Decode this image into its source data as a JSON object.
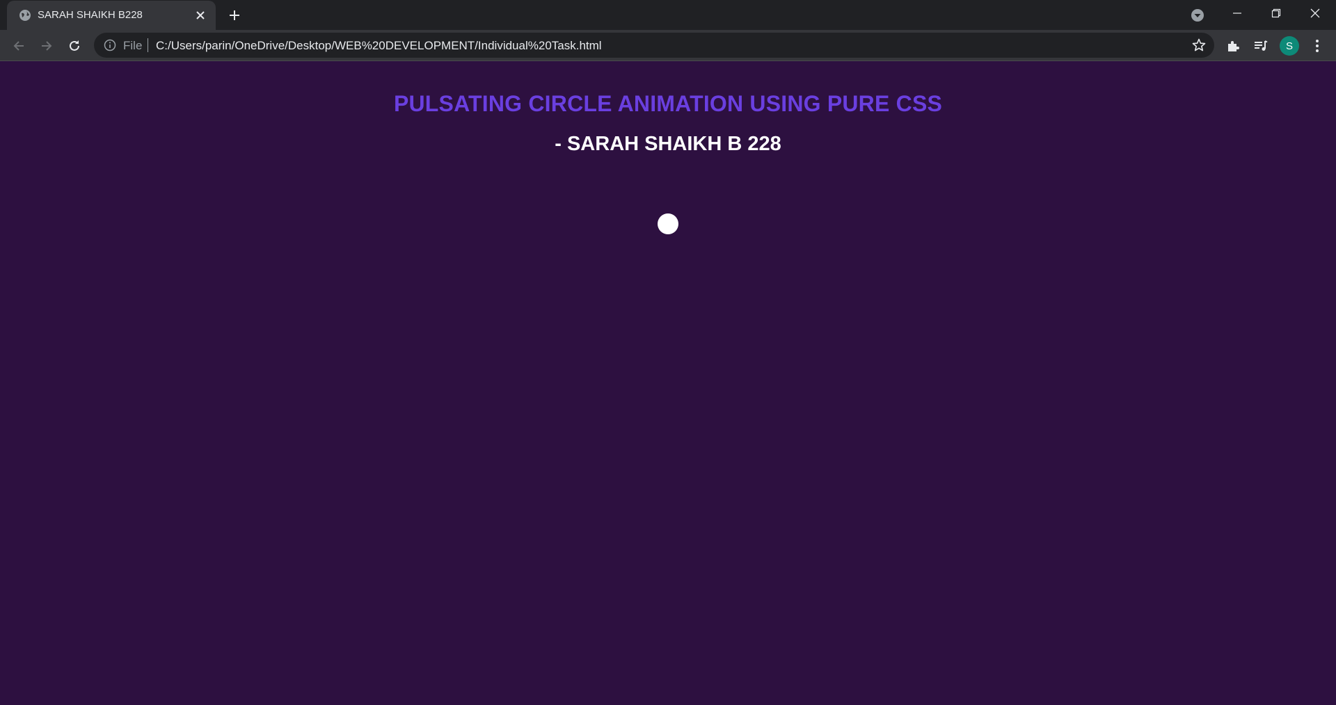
{
  "browser": {
    "tab": {
      "title": "SARAH SHAIKH B228"
    },
    "omnibox": {
      "scheme_label": "File",
      "url": "C:/Users/parin/OneDrive/Desktop/WEB%20DEVELOPMENT/Individual%20Task.html"
    },
    "profile": {
      "initial": "S",
      "color": "#0d8a78"
    },
    "icons": {
      "favicon": "globe-icon",
      "tab_close": "close-icon",
      "new_tab": "plus-icon",
      "tab_search": "tab-search-icon",
      "minimize": "minimize-icon",
      "restore": "restore-icon",
      "close_window": "close-icon",
      "back": "arrow-left-icon",
      "forward": "arrow-right-icon",
      "reload": "reload-icon",
      "site_info": "info-icon",
      "bookmark": "star-icon",
      "extensions": "puzzle-icon",
      "media": "media-queue-icon",
      "menu": "kebab-menu-icon"
    }
  },
  "page": {
    "heading": "PULSATING CIRCLE ANIMATION USING PURE CSS",
    "subheading": "- SARAH SHAIKH B 228",
    "colors": {
      "background": "#2d1040",
      "heading": "#6a3fe0",
      "subheading": "#ffffff",
      "circle": "#ffffff"
    }
  }
}
